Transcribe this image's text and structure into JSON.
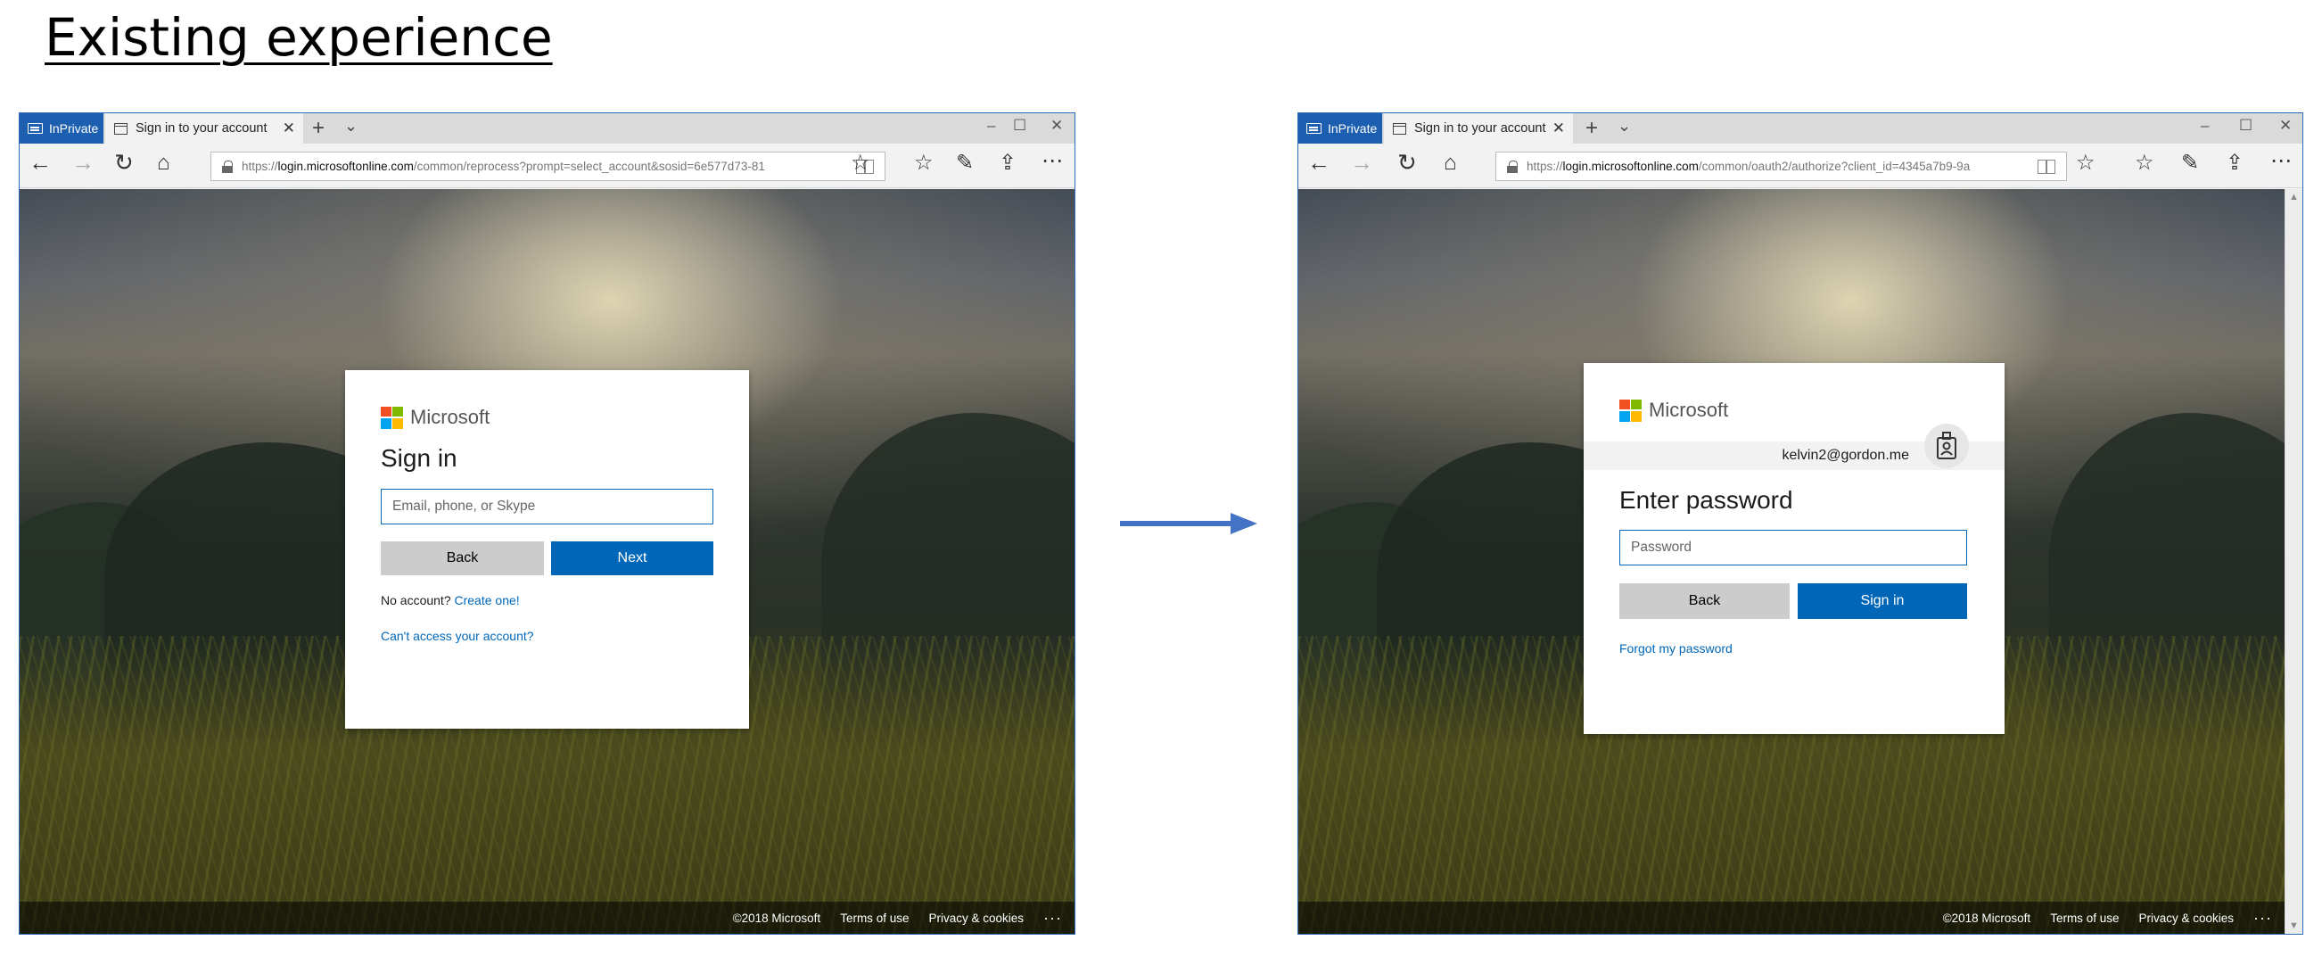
{
  "slide": {
    "title": "Existing experience"
  },
  "window_left": {
    "inprivate_label": "InPrivate",
    "tab_title": "Sign in to your account",
    "url_prefix": "https://",
    "url_host": "login.microsoftonline.com",
    "url_path": "/common/reprocess?prompt=select_account&sosid=6e577d73-81",
    "card": {
      "brand": "Microsoft",
      "heading": "Sign in",
      "input_placeholder": "Email, phone, or Skype",
      "back_label": "Back",
      "next_label": "Next",
      "no_account_text": "No account?",
      "create_link": "Create one!",
      "cant_access_link": "Can't access your account?"
    },
    "footer": {
      "copyright": "©2018 Microsoft",
      "terms": "Terms of use",
      "privacy": "Privacy & cookies",
      "more": "···"
    }
  },
  "window_right": {
    "inprivate_label": "InPrivate",
    "tab_title": "Sign in to your account",
    "url_prefix": "https://",
    "url_host": "login.microsoftonline.com",
    "url_path": "/common/oauth2/authorize?client_id=4345a7b9-9a",
    "card": {
      "brand": "Microsoft",
      "account_email": "kelvin2@gordon.me",
      "heading": "Enter password",
      "input_placeholder": "Password",
      "back_label": "Back",
      "signin_label": "Sign in",
      "forgot_link": "Forgot my password"
    },
    "footer": {
      "copyright": "©2018 Microsoft",
      "terms": "Terms of use",
      "privacy": "Privacy & cookies",
      "more": "···"
    }
  },
  "colors": {
    "accent": "#0067b8",
    "inprivate": "#1c5fb0",
    "arrow": "#4472c4",
    "secondary_button": "#cccccc"
  },
  "icons": [
    "inprivate-icon",
    "page-icon",
    "close-icon",
    "plus-icon",
    "chevron-down-icon",
    "minimize-icon",
    "maximize-icon",
    "window-close-icon",
    "back-arrow-icon",
    "forward-arrow-icon",
    "refresh-icon",
    "home-icon",
    "lock-icon",
    "reading-view-icon",
    "star-icon",
    "favorites-icon",
    "pen-icon",
    "share-icon",
    "more-icon",
    "badge-icon",
    "arrow-icon"
  ]
}
